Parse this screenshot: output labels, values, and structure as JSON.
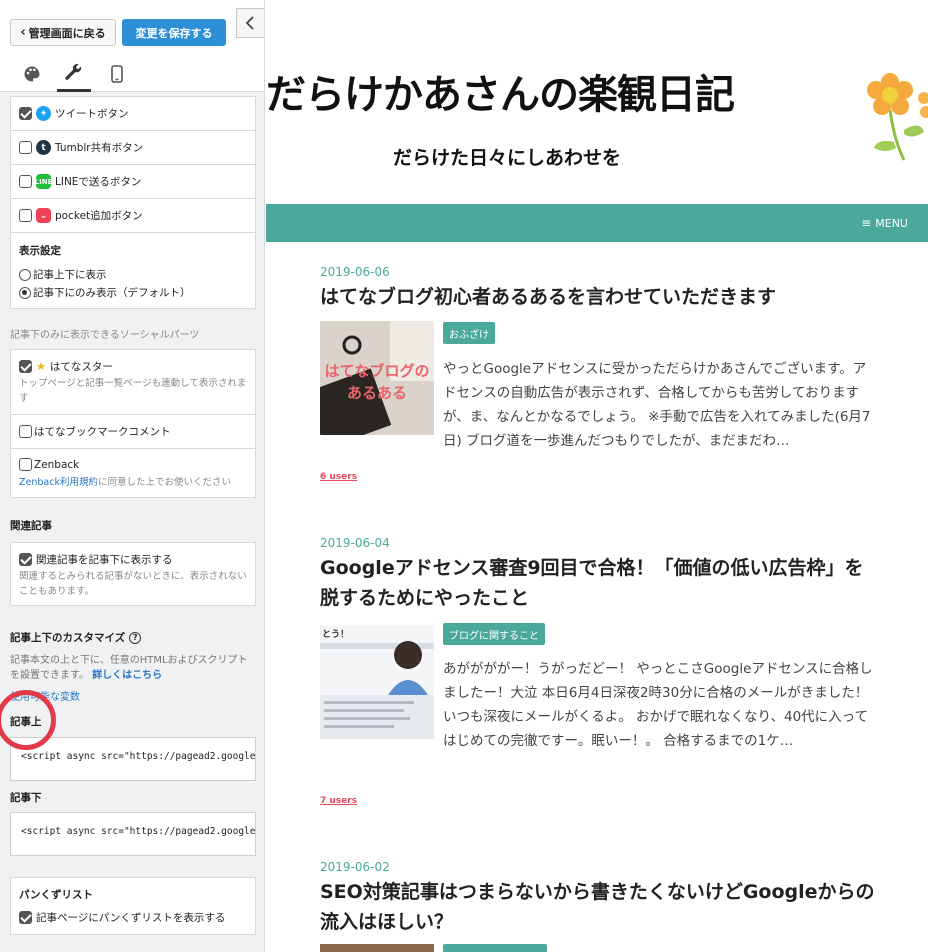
{
  "sidebar": {
    "back_label": "管理画面に戻る",
    "save_label": "変更を保存する",
    "share_items": [
      {
        "label": "ツイートボタン",
        "checked": true
      },
      {
        "label": "Tumblr共有ボタン",
        "checked": false
      },
      {
        "label": "LINEで送るボタン",
        "checked": false
      },
      {
        "label": "pocket追加ボタン",
        "checked": false
      }
    ],
    "display_setting": {
      "heading": "表示設定",
      "option1": "記事上下に表示",
      "option2": "記事下にのみ表示（デフォルト）"
    },
    "bottom_only_heading": "記事下のみに表示できるソーシャルパーツ",
    "hatena_star": {
      "label": "はてなスター",
      "note": "トップページと記事一覧ページも連動して表示されます"
    },
    "hatena_bookmark": {
      "label": "はてなブックマークコメント"
    },
    "zenback": {
      "label": "Zenback",
      "link": "Zenback利用規約",
      "note": "に同意した上でお使いください"
    },
    "related": {
      "heading": "関連記事",
      "label": "関連記事を記事下に表示する",
      "note": "関連するとみられる記事がないときに、表示されないこともあります。"
    },
    "customize": {
      "heading": "記事上下のカスタマイズ",
      "desc": "記事本文の上と下に、任意のHTMLおよびスクリプトを設置できます。",
      "detail_link": "詳しくはこちら",
      "vars_link": "使用可能な変数",
      "above_label": "記事上",
      "above_code": "<script async src=\"https://pagead2.googlesyndication",
      "below_label": "記事下",
      "below_code": "<script async src=\"https://pagead2.googlesyndication"
    },
    "breadcrumb": {
      "heading": "パンくずリスト",
      "label": "記事ページにパンくずリストを表示する"
    }
  },
  "preview": {
    "site_title": "だらけかあさんの楽観日記",
    "site_desc": "だらけた日々にしあわせを",
    "menu_label": "MENU",
    "posts": [
      {
        "date": "2019-06-06",
        "title": "はてなブログ初心者あるあるを言わせていただきます",
        "tag": "おふざけ",
        "thumb_text_1": "はてなブログの",
        "thumb_text_2": "あるある",
        "excerpt": "やっとGoogleアドセンスに受かっただらけかあさんでございます。アドセンスの自動広告が表示されず、合格してからも苦労しておりますが、ま、なんとかなるでしょう。 ※手動で広告を入れてみました(6月7日) ブログ道を一歩進んだつもりでしたが、まだまだわ…",
        "users": "6 users"
      },
      {
        "date": "2019-06-04",
        "title": "Googleアドセンス審査9回目で合格！「価値の低い広告枠」を脱するためにやったこと",
        "tag": "ブログに関すること",
        "thumb_text_1": "とう！",
        "excerpt": "あががががー！うがっだどー！ やっとこさGoogleアドセンスに合格しましたー！大泣 本日6月4日深夜2時30分に合格のメールがきました！いつも深夜にメールがくるよ。 おかげで眠れなくなり、40代に入ってはじめての完徹ですー。眠いー！。 合格するまでの1ケ…",
        "users": "7 users"
      },
      {
        "date": "2019-06-02",
        "title": "SEO対策記事はつまらないから書きたくないけどGoogleからの流入はほしい？"
      }
    ]
  },
  "colors": {
    "accent": "#4aa99b",
    "save": "#2d8fd7",
    "mark": "#e23a48"
  }
}
